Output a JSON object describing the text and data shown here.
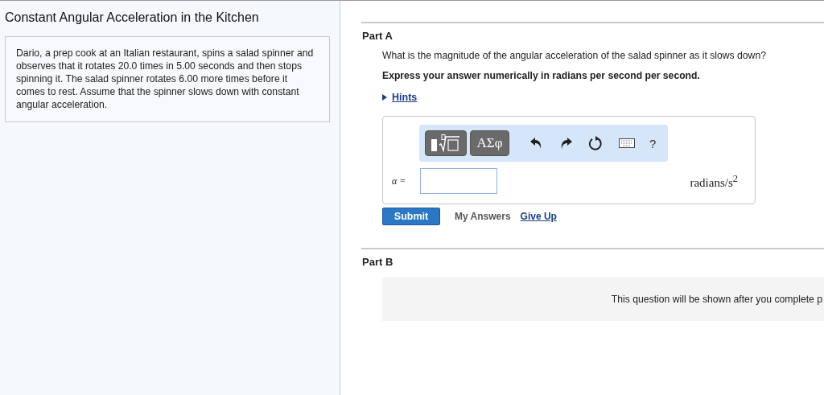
{
  "title": "Constant Angular Acceleration in the Kitchen",
  "intro": "Dario, a prep cook at an Italian restaurant, spins a salad spinner and observes that it rotates 20.0 times in 5.00 seconds and then stops spinning it. The salad spinner rotates 6.00 more times before it comes to rest. Assume that the spinner slows down with constant angular acceleration.",
  "part_a": {
    "heading": "Part A",
    "question": "What is the magnitude of the angular acceleration of the salad spinner as it slows down?",
    "instruction": "Express your answer numerically in radians per second per second.",
    "hints": {
      "label": "Hints",
      "expanded": false
    },
    "toolbar": {
      "greek": "ΑΣφ",
      "help": "?"
    },
    "answer": {
      "label": "α =",
      "units": "radians/s$^{2}$"
    },
    "submit": "Submit",
    "my_answers": "My Answers",
    "give_up": "Give Up"
  },
  "part_b": {
    "heading": "Part B",
    "notice": "This question will be shown after you complete p"
  }
}
